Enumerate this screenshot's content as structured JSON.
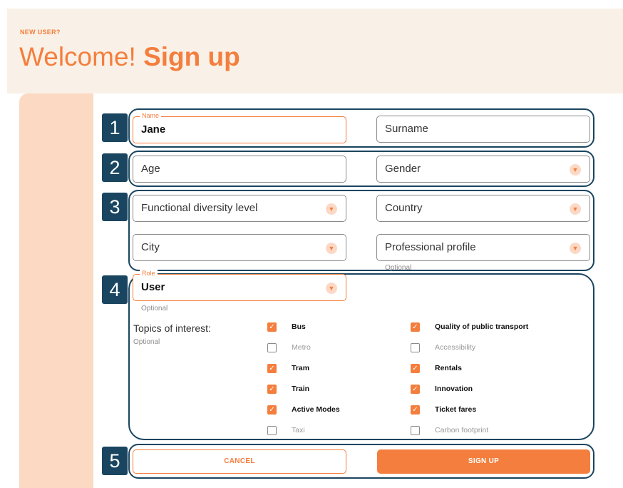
{
  "header": {
    "eyebrow": "NEW USER?",
    "title_plain": "Welcome!",
    "title_strong": "Sign up"
  },
  "markers": [
    "1",
    "2",
    "3",
    "4",
    "5"
  ],
  "fields": {
    "name": {
      "label": "Name",
      "value": "Jane"
    },
    "surname": {
      "placeholder": "Surname"
    },
    "age": {
      "placeholder": "Age"
    },
    "gender": {
      "placeholder": "Gender"
    },
    "functional_diversity": {
      "placeholder": "Functional diversity level"
    },
    "country": {
      "placeholder": "Country"
    },
    "city": {
      "placeholder": "City"
    },
    "professional_profile": {
      "placeholder": "Professional profile",
      "hint": "Optional"
    },
    "role": {
      "label": "Role",
      "value": "User",
      "hint": "Optional"
    }
  },
  "topics": {
    "label": "Topics of interest:",
    "hint": "Optional",
    "left": [
      {
        "label": "Bus",
        "checked": true
      },
      {
        "label": "Metro",
        "checked": false
      },
      {
        "label": "Tram",
        "checked": true
      },
      {
        "label": "Train",
        "checked": true
      },
      {
        "label": "Active Modes",
        "checked": true
      },
      {
        "label": "Taxi",
        "checked": false
      }
    ],
    "right": [
      {
        "label": "Quality of public transport",
        "checked": true
      },
      {
        "label": "Accessibility",
        "checked": false
      },
      {
        "label": "Rentals",
        "checked": true
      },
      {
        "label": "Innovation",
        "checked": true
      },
      {
        "label": "Ticket fares",
        "checked": true
      },
      {
        "label": "Carbon footprint",
        "checked": false
      }
    ]
  },
  "buttons": {
    "cancel": "CANCEL",
    "signup": "SIGN UP"
  },
  "icons": {
    "dropdown": "chevron-down-icon",
    "check": "checkmark-icon"
  },
  "colors": {
    "accent": "#f47e3d",
    "annotation": "#1a4560",
    "header_bg": "#f9f1e7",
    "side_panel": "#fcd9c3"
  }
}
